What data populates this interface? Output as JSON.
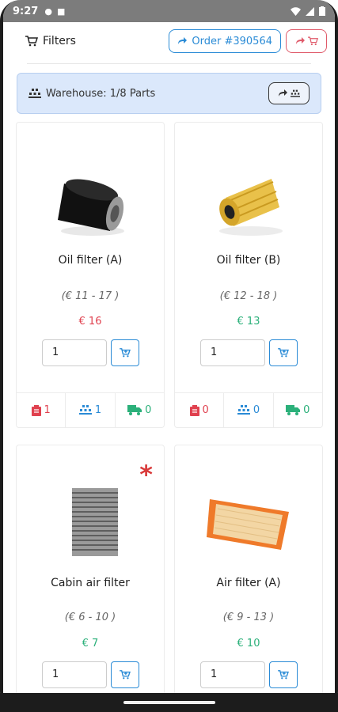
{
  "status": {
    "time": "9:27"
  },
  "toolbar": {
    "filters_label": "Filters",
    "order_label": "Order #390564"
  },
  "warehouse": {
    "label": "Warehouse: 1/8 Parts"
  },
  "products": [
    {
      "name": "Oil filter (A)",
      "range": "(€ 11 - 17 )",
      "price": "€ 16",
      "qty": "1",
      "stat_clipboard": "1",
      "stat_pallet": "1",
      "stat_truck": "0"
    },
    {
      "name": "Oil filter (B)",
      "range": "(€ 12 - 18 )",
      "price": "€ 13",
      "qty": "1",
      "stat_clipboard": "0",
      "stat_pallet": "0",
      "stat_truck": "0"
    },
    {
      "name": "Cabin air filter",
      "range": "(€ 6 - 10 )",
      "price": "€ 7",
      "qty": "1",
      "marker": "*"
    },
    {
      "name": "Air filter (A)",
      "range": "(€ 9 - 13 )",
      "price": "€ 10",
      "qty": "1"
    }
  ],
  "icons": {
    "cart": "cart-icon",
    "share": "share-arrow-icon",
    "warehouse": "warehouse-icon",
    "clipboard": "clipboard-icon",
    "pallet": "pallet-icon",
    "truck": "truck-icon"
  },
  "colors": {
    "accent": "#2a8bd6",
    "danger": "#e0414f",
    "success": "#2bb07a",
    "banner": "#dbe8fb"
  }
}
